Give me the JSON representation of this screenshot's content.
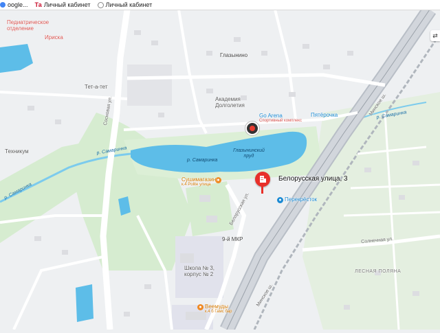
{
  "bookmarks": [
    {
      "label": "oogle...",
      "icon": "google-icon"
    },
    {
      "label": "Личный кабинет",
      "icon": "tbank-icon",
      "badge": "Та"
    },
    {
      "label": "Личный кабинет",
      "icon": "globe-icon"
    }
  ],
  "map": {
    "colors": {
      "background": "#eef0f2",
      "water": "#5dbde8",
      "greenery": "#d6ecd0",
      "highway": "#b8bec6",
      "road": "#ffffff",
      "pin": "#e8302a",
      "accent_blue": "#1b8ad3"
    },
    "labels": {
      "pediatric": "Педиатрическое отделение",
      "irishka": "Ириска",
      "tet_a_tet": "Тет-а-тет",
      "glaznyno": "Глазынино",
      "academy": "Академия Долголетия",
      "go_arena": "Go Arena",
      "go_arena_sub": "Спортивный комплекс",
      "pyaterochka": "Пятёрочка",
      "sosnovaya": "Сосновая ул.",
      "tekhnikum": "Техникум",
      "samarinka_river_w": "р. Самаринка",
      "samarinka_river_nw": "р. Самаринка",
      "samarinka_pond": "р. Самаринка",
      "glaznynsky_pond": "Глазынинский пруд",
      "samarinka_river_e": "р. Самаринка",
      "minskoe_top": "Минское ш.",
      "minskoe_bottom": "Минское ш.",
      "sushi": "Сушимагазин",
      "sushi_sub": "к.4 Polite улица",
      "perekrestok": "Перекрёсток",
      "belorusskaya_street": "Белорусская ул.",
      "mkr": "9-й МКР",
      "school": "Школа № 3, корпус № 2",
      "veemudy": "Веемуды",
      "veemudy_sub": "к.4 б Гамс бар",
      "solnechnaya": "Солнечная ул.",
      "lesnaya_polyana": "ЛЕСНАЯ ПОЛЯНА",
      "address": "Белорусская улица, 3"
    }
  }
}
